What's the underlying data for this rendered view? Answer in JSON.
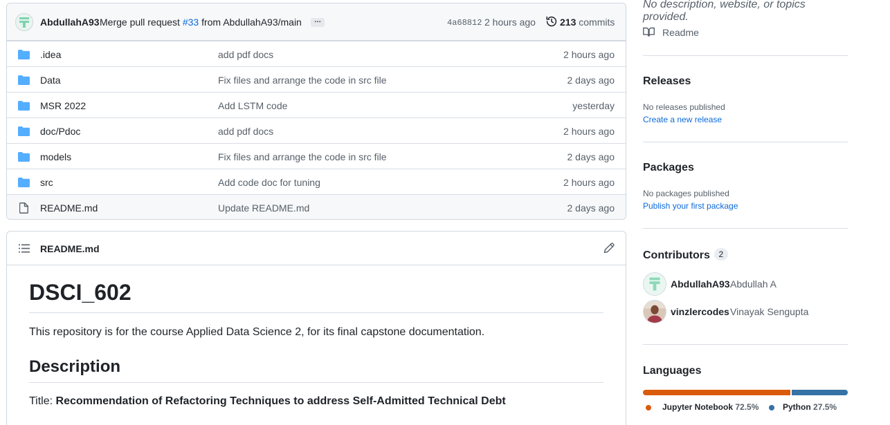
{
  "commit": {
    "author": "AbdullahA93",
    "message_prefix": "Merge pull request",
    "pr_link": "#33",
    "message_suffix": "from AbdullahA93/main",
    "ellipsis": "…",
    "sha": "4a68812",
    "time": "2 hours ago",
    "commit_count": "213",
    "commits_label": "commits"
  },
  "files": [
    {
      "name": ".idea",
      "type": "folder",
      "message": "add pdf docs",
      "age": "2 hours ago"
    },
    {
      "name": "Data",
      "type": "folder",
      "message": "Fix files and arrange the code in src file",
      "age": "2 days ago"
    },
    {
      "name": "MSR 2022",
      "type": "folder",
      "message": "Add LSTM code",
      "age": "yesterday"
    },
    {
      "name": "doc/Pdoc",
      "type": "folder",
      "message": "add pdf docs",
      "age": "2 hours ago"
    },
    {
      "name": "models",
      "type": "folder",
      "message": "Fix files and arrange the code in src file",
      "age": "2 days ago"
    },
    {
      "name": "src",
      "type": "folder",
      "message": "Add code doc for tuning",
      "age": "2 hours ago"
    },
    {
      "name": "README.md",
      "type": "file",
      "message": "Update README.md",
      "age": "2 days ago"
    }
  ],
  "readme": {
    "header": "README.md",
    "h1": "DSCI_602",
    "lead": "This repository is for the course Applied Data Science 2, for its final capstone documentation.",
    "h2": "Description",
    "title_prefix": "Title:",
    "title_text": "Recommendation of Refactoring Techniques to address Self-Admitted Technical Debt"
  },
  "sidebar": {
    "about_description": "No description, website, or topics provided.",
    "readme_label": "Readme",
    "releases": {
      "title": "Releases",
      "empty": "No releases published",
      "link": "Create a new release"
    },
    "packages": {
      "title": "Packages",
      "empty": "No packages published",
      "link": "Publish your first package"
    },
    "contributors": {
      "title": "Contributors",
      "count": "2",
      "people": [
        {
          "login": "AbdullahA93",
          "name": "Abdullah A"
        },
        {
          "login": "vinzlercodes",
          "name": "Vinayak Sengupta"
        }
      ]
    },
    "languages": {
      "title": "Languages",
      "items": [
        {
          "name": "Jupyter Notebook",
          "percent": "72.5%",
          "value": 72.5,
          "color": "#DA5B0B"
        },
        {
          "name": "Python",
          "percent": "27.5%",
          "value": 27.5,
          "color": "#3572A5"
        }
      ]
    }
  }
}
